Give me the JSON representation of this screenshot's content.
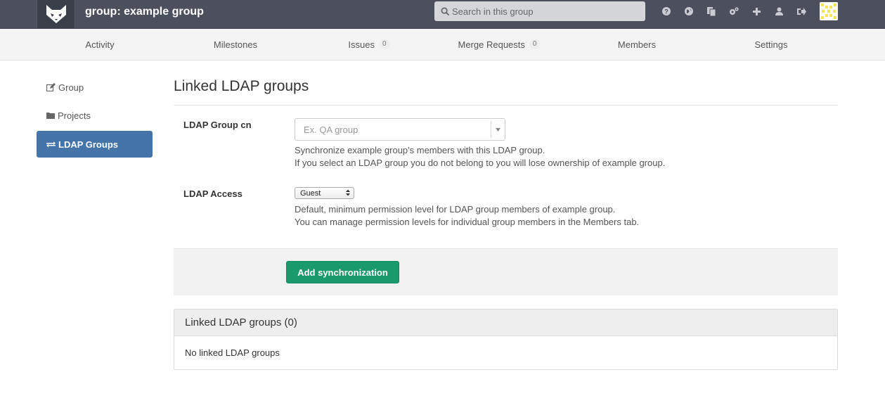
{
  "header": {
    "title": "group: example group",
    "search_placeholder": "Search in this group",
    "icons": [
      "help-icon",
      "globe-icon",
      "copy-icon",
      "gears-icon",
      "plus-icon",
      "user-icon",
      "sign-out-icon"
    ]
  },
  "nav": {
    "items": [
      {
        "label": "Activity"
      },
      {
        "label": "Milestones"
      },
      {
        "label": "Issues",
        "count": "0"
      },
      {
        "label": "Merge Requests",
        "count": "0"
      },
      {
        "label": "Members"
      },
      {
        "label": "Settings"
      }
    ]
  },
  "sidebar": {
    "items": [
      {
        "label": "Group",
        "icon": "edit-icon"
      },
      {
        "label": "Projects",
        "icon": "folder-icon"
      },
      {
        "label": "LDAP Groups",
        "icon": "exchange-icon",
        "active": true
      }
    ]
  },
  "main": {
    "title": "Linked LDAP groups",
    "ldap_cn": {
      "label": "LDAP Group cn",
      "placeholder": "Ex. QA group",
      "help_line1": "Synchronize example group's members with this LDAP group.",
      "help_line2": "If you select an LDAP group you do not belong to you will lose ownership of example group."
    },
    "ldap_access": {
      "label": "LDAP Access",
      "selected": "Guest",
      "help_line1": "Default, minimum permission level for LDAP group members of example group.",
      "help_line2": "You can manage permission levels for individual group members in the Members tab."
    },
    "add_button": "Add synchronization",
    "panel": {
      "title": "Linked LDAP groups (0)",
      "empty": "No linked LDAP groups"
    }
  },
  "colors": {
    "header_bg": "#4b505c",
    "active_sidebar": "#4474a8",
    "primary_button": "#1a9a6c"
  }
}
